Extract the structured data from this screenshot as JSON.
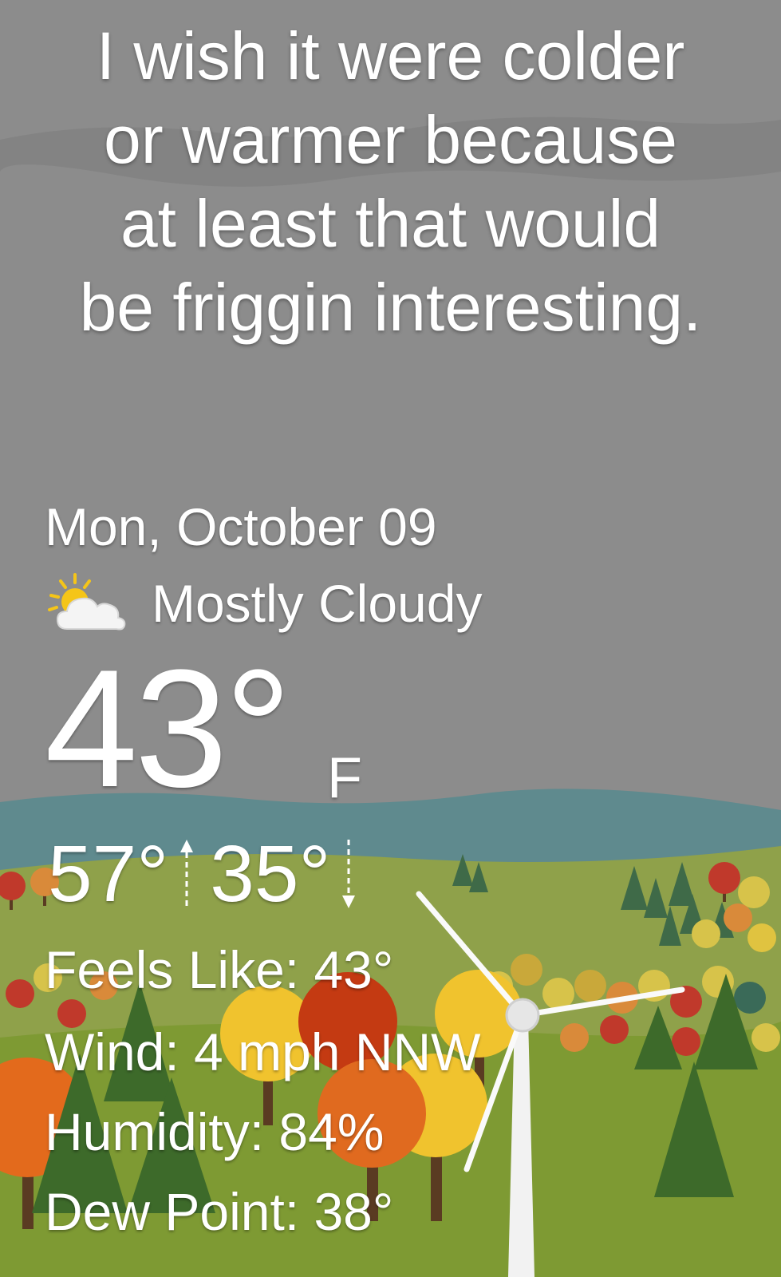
{
  "message": {
    "lines": [
      "I wish it were colder",
      "or warmer because",
      "at least that would",
      "be friggin interesting."
    ]
  },
  "weather": {
    "date": "Mon, October 09",
    "condition": "Mostly Cloudy",
    "condition_icon": "partly-cloudy-icon",
    "temperature": "43°",
    "unit": "F",
    "high": "57°",
    "low": "35°",
    "details": {
      "feels_like": "Feels Like:  43°",
      "wind": "Wind:  4 mph NNW",
      "humidity": "Humidity:  84%",
      "dew_point": "Dew Point:  38°"
    }
  },
  "colors": {
    "sky": "#8c8c8c",
    "hills": "#5f8a8e",
    "meadow": "#8fa14a",
    "grass": "#7e9a33"
  }
}
